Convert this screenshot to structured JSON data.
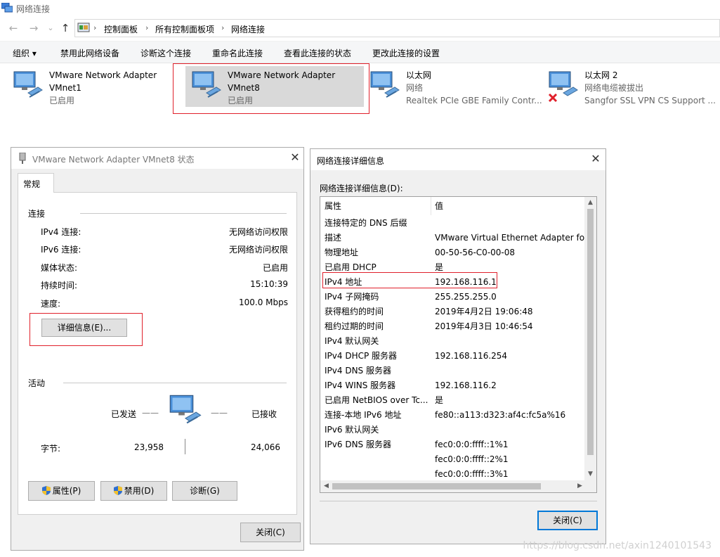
{
  "window": {
    "title": "网络连接"
  },
  "nav": {
    "back": "←",
    "forward": "→",
    "recent": "⌄",
    "up": "↑"
  },
  "address": {
    "crumbs": [
      "控制面板",
      "所有控制面板项",
      "网络连接"
    ],
    "sep": "›"
  },
  "commands": {
    "organize": "组织 ▾",
    "disable_device": "禁用此网络设备",
    "diagnose": "诊断这个连接",
    "rename": "重命名此连接",
    "view_status": "查看此连接的状态",
    "change_settings": "更改此连接的设置"
  },
  "adapters": [
    {
      "name": "VMware Network Adapter",
      "line2": "VMnet1",
      "line3": "已启用"
    },
    {
      "name": "VMware Network Adapter",
      "line2": "VMnet8",
      "line3": "已启用"
    },
    {
      "name": "以太网",
      "line2": "网络",
      "line3": "Realtek PCIe GBE Family Contr..."
    },
    {
      "name": "以太网 2",
      "line2": "网络电缆被拔出",
      "line3": "Sangfor SSL VPN CS Support ..."
    }
  ],
  "status_dialog": {
    "title": "VMware Network Adapter VMnet8 状态",
    "tab": "常规",
    "connection_header": "连接",
    "rows": [
      {
        "label": "IPv4 连接:",
        "value": "无网络访问权限"
      },
      {
        "label": "IPv6 连接:",
        "value": "无网络访问权限"
      },
      {
        "label": "媒体状态:",
        "value": "已启用"
      },
      {
        "label": "持续时间:",
        "value": "15:10:39"
      },
      {
        "label": "速度:",
        "value": "100.0 Mbps"
      }
    ],
    "details_button": "详细信息(E)...",
    "activity_header": "活动",
    "sent_label": "已发送",
    "received_label": "已接收",
    "dash": "——",
    "bytes_label": "字节:",
    "bytes_sent": "23,958",
    "bytes_received": "24,066",
    "properties_button": "属性(P)",
    "disable_button": "禁用(D)",
    "diagnose_button": "诊断(G)",
    "close_button": "关闭(C)"
  },
  "details_dialog": {
    "title": "网络连接详细信息",
    "list_label": "网络连接详细信息(D):",
    "col_property": "属性",
    "col_value": "值",
    "rows": [
      {
        "p": "连接特定的 DNS 后缀",
        "v": ""
      },
      {
        "p": "描述",
        "v": "VMware Virtual Ethernet Adapter for"
      },
      {
        "p": "物理地址",
        "v": "00-50-56-C0-00-08"
      },
      {
        "p": "已启用 DHCP",
        "v": "是"
      },
      {
        "p": "IPv4 地址",
        "v": "192.168.116.1"
      },
      {
        "p": "IPv4 子网掩码",
        "v": "255.255.255.0"
      },
      {
        "p": "获得租约的时间",
        "v": "2019年4月2日 19:06:48"
      },
      {
        "p": "租约过期的时间",
        "v": "2019年4月3日 10:46:54"
      },
      {
        "p": "IPv4 默认网关",
        "v": ""
      },
      {
        "p": "IPv4 DHCP 服务器",
        "v": "192.168.116.254"
      },
      {
        "p": "IPv4 DNS 服务器",
        "v": ""
      },
      {
        "p": "IPv4 WINS 服务器",
        "v": "192.168.116.2"
      },
      {
        "p": "已启用 NetBIOS over Tc...",
        "v": "是"
      },
      {
        "p": "连接-本地 IPv6 地址",
        "v": "fe80::a113:d323:af4c:fc5a%16"
      },
      {
        "p": "IPv6 默认网关",
        "v": ""
      },
      {
        "p": "IPv6 DNS 服务器",
        "v": "fec0:0:0:ffff::1%1"
      },
      {
        "p": "",
        "v": "fec0:0:0:ffff::2%1"
      },
      {
        "p": "",
        "v": "fec0:0:0:ffff::3%1"
      }
    ],
    "close_button": "关闭(C)"
  },
  "watermark": "https://blog.csdn.net/axin1240101543",
  "colors": {
    "highlight_box": "#e0202b",
    "selected_bg": "#d9d9d9",
    "focus_border": "#0078d7"
  }
}
